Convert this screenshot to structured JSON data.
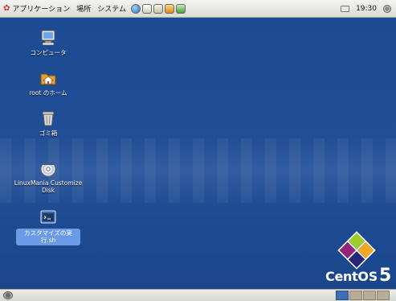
{
  "top_panel": {
    "menus": [
      "アプリケーション",
      "場所",
      "システム"
    ],
    "launchers": [
      "globe-icon",
      "mail-icon",
      "document-icon",
      "presentation-icon",
      "spreadsheet-icon"
    ],
    "clock": "19:30"
  },
  "desktop": {
    "icons": [
      {
        "label": "コンピュータ",
        "icon": "computer-icon"
      },
      {
        "label": "root のホーム",
        "icon": "home-folder-icon"
      },
      {
        "label": "ゴミ箱",
        "icon": "trash-icon"
      },
      {
        "label": "LinuxMania Customize Disk",
        "icon": "cd-disk-icon"
      },
      {
        "label": "カスタマイズの実行.sh",
        "icon": "script-file-icon",
        "selected": true
      }
    ]
  },
  "branding": {
    "logo_word": "CentOS",
    "logo_version": "5"
  },
  "bottom_panel": {
    "workspaces": 4,
    "active_workspace": 1
  },
  "colors": {
    "desktop": "#1f4c95",
    "panel": "#dcdcd6",
    "selection": "#6b9be6"
  }
}
